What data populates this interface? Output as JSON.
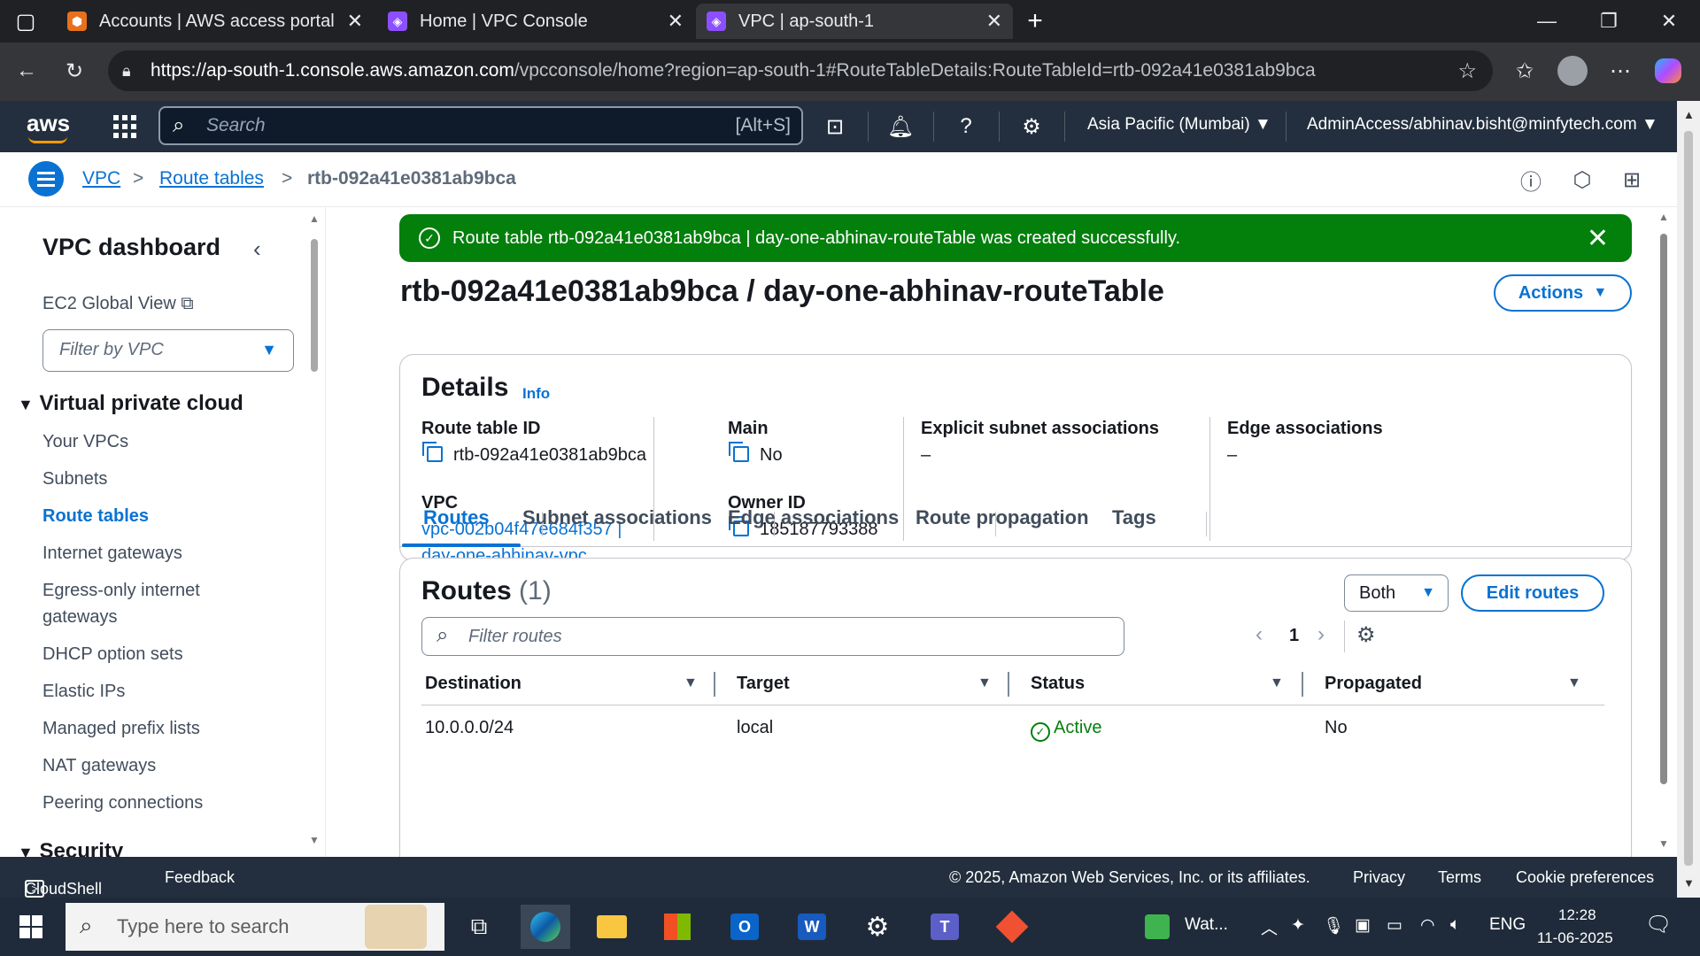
{
  "browser": {
    "tabs": [
      {
        "title": "Accounts | AWS access portal",
        "close": "✕"
      },
      {
        "title": "Home | VPC Console",
        "close": "✕"
      },
      {
        "title": "VPC | ap-south-1",
        "close": "✕"
      }
    ],
    "new_tab": "+",
    "url_host": "https://ap-south-1.console.aws.amazon.com",
    "url_rest": "/vpcconsole/home?region=ap-south-1#RouteTableDetails:RouteTableId=rtb-092a41e0381ab9bca"
  },
  "aws_header": {
    "logo": "aws",
    "search_placeholder": "Search",
    "search_shortcut": "[Alt+S]",
    "region": "Asia Pacific (Mumbai) ▼",
    "account": "AdminAccess/abhinav.bisht@minfytech.com ▼"
  },
  "breadcrumb": {
    "items": [
      "VPC",
      "Route tables"
    ],
    "current": "rtb-092a41e0381ab9bca",
    "sep": ">"
  },
  "sidebar": {
    "title": "VPC dashboard",
    "ec2_global_view": "EC2 Global View",
    "filter_placeholder": "Filter by VPC",
    "section_vpc": "Virtual private cloud",
    "items": [
      "Your VPCs",
      "Subnets",
      "Route tables",
      "Internet gateways",
      "Egress-only internet",
      "gateways",
      "DHCP option sets",
      "Elastic IPs",
      "Managed prefix lists",
      "NAT gateways",
      "Peering connections"
    ],
    "section_security": "Security"
  },
  "flash": {
    "message": "Route table rtb-092a41e0381ab9bca | day-one-abhinav-routeTable was created successfully."
  },
  "page": {
    "title": "rtb-092a41e0381ab9bca / day-one-abhinav-routeTable",
    "actions_label": "Actions"
  },
  "details": {
    "title": "Details",
    "info": "Info",
    "route_table_id_label": "Route table ID",
    "route_table_id": "rtb-092a41e0381ab9bca",
    "main_label": "Main",
    "main": "No",
    "explicit_label": "Explicit subnet associations",
    "explicit": "–",
    "edge_label": "Edge associations",
    "edge": "–",
    "vpc_label": "VPC",
    "vpc_line1": "vpc-002b04f47e684f357 |",
    "vpc_line2": "day-one-abhinav-vpc",
    "owner_label": "Owner ID",
    "owner": "185187793388"
  },
  "tabs": [
    "Routes",
    "Subnet associations",
    "Edge associations",
    "Route propagation",
    "Tags"
  ],
  "routes": {
    "title": "Routes",
    "count": "(1)",
    "both_label": "Both",
    "edit_label": "Edit routes",
    "filter_placeholder": "Filter routes",
    "page": "1",
    "columns": [
      "Destination",
      "Target",
      "Status",
      "Propagated"
    ],
    "rows": [
      {
        "destination": "10.0.0.0/24",
        "target": "local",
        "status": "Active",
        "propagated": "No"
      }
    ]
  },
  "footer": {
    "cloudshell": "CloudShell",
    "feedback": "Feedback",
    "copyright": "© 2025, Amazon Web Services, Inc. or its affiliates.",
    "privacy": "Privacy",
    "terms": "Terms",
    "cookies": "Cookie preferences"
  },
  "taskbar": {
    "search_placeholder": "Type here to search",
    "weather": "Wat...",
    "lang": "ENG",
    "time": "12:28",
    "date": "11-06-2025"
  },
  "colors": {
    "aws_dark": "#232f3e",
    "link_blue": "#0972d3",
    "success_green": "#037f0c"
  }
}
